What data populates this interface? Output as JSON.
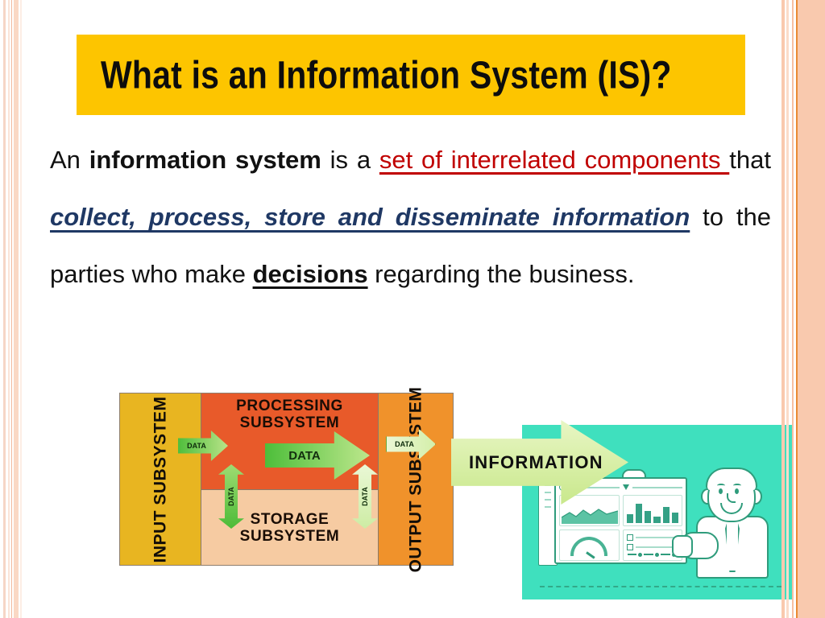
{
  "slide": {
    "title": "What is an Information System (IS)?",
    "banner_color": "#FDC500",
    "accent_red": "#C00000",
    "accent_navy": "#1F3864"
  },
  "body": {
    "seg_an": "An ",
    "seg_information_system": "information system",
    "seg_is_a": " is a ",
    "seg_set_of_interrelated": "set of interrelated components ",
    "seg_that": "that ",
    "seg_collect_process": "collect, process, store and disseminate information",
    "seg_to_parties": " to the parties who make ",
    "seg_decisions": "decisions",
    "seg_regarding": " regarding the business."
  },
  "diagram": {
    "input_label": "INPUT SUBSYSTEM",
    "processing_label": "PROCESSING SUBSYSTEM",
    "storage_label": "STORAGE SUBSYSTEM",
    "output_label": "OUTPUT SUBSYSTEM",
    "data_arrow_1": "DATA",
    "data_arrow_2": "DATA",
    "data_arrow_3": "DATA",
    "data_arrow_4": "DATA",
    "data_arrow_5": "DATA",
    "information_arrow": "INFORMATION",
    "colors": {
      "input": "#E8B521",
      "processing": "#E85A2A",
      "storage": "#F6CBA2",
      "output": "#F0922B",
      "data_arrow": "#4CBB38",
      "information_arrow": "#C9E88C",
      "teal_panel": "#3FE0BE"
    }
  }
}
